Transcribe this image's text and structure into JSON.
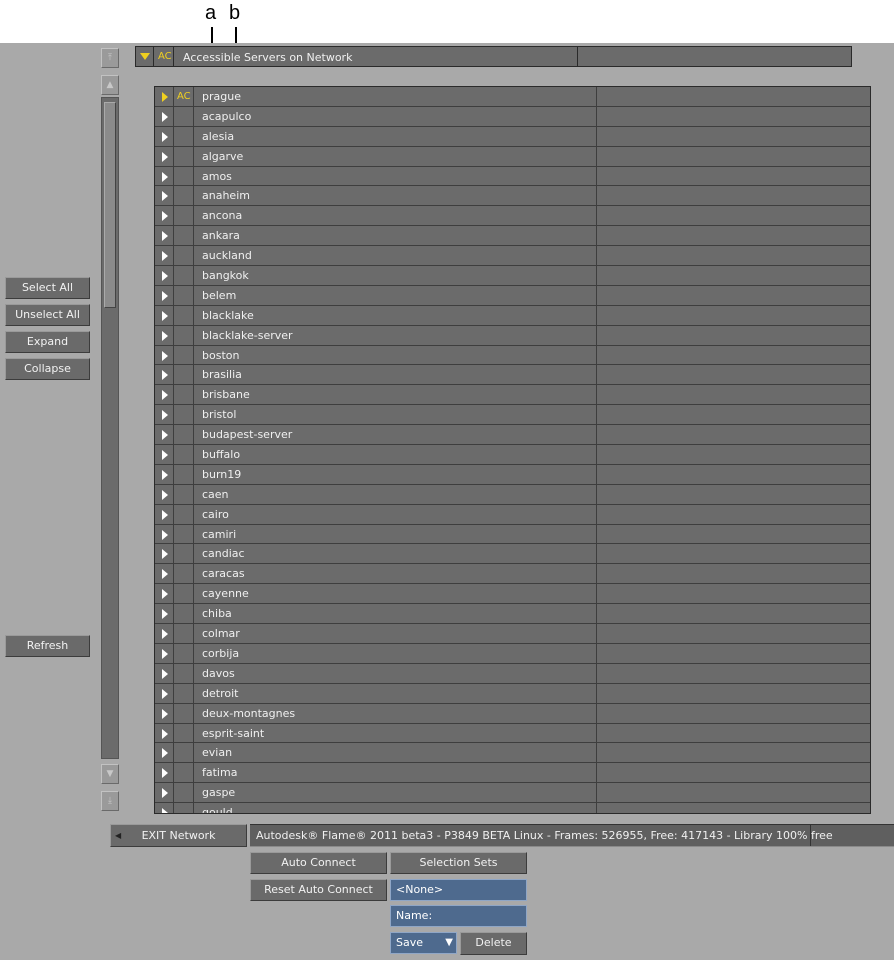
{
  "callouts": {
    "a": "a",
    "b": "b"
  },
  "left_buttons": {
    "select_all": "Select All",
    "unselect_all": "Unselect All",
    "expand": "Expand",
    "collapse": "Collapse",
    "refresh": "Refresh"
  },
  "header": {
    "ac": "AC",
    "title": "Accessible Servers on Network"
  },
  "list": {
    "ac": "AC",
    "rows": [
      "prague",
      "acapulco",
      "alesia",
      "algarve",
      "amos",
      "anaheim",
      "ancona",
      "ankara",
      "auckland",
      "bangkok",
      "belem",
      "blacklake",
      "blacklake-server",
      "boston",
      "brasilia",
      "brisbane",
      "bristol",
      "budapest-server",
      "buffalo",
      "burn19",
      "caen",
      "cairo",
      "camiri",
      "candiac",
      "caracas",
      "cayenne",
      "chiba",
      "colmar",
      "corbija",
      "davos",
      "detroit",
      "deux-montagnes",
      "esprit-saint",
      "evian",
      "fatima",
      "gaspe",
      "gould"
    ]
  },
  "footer": {
    "exit_label": "EXIT Network",
    "status": "Autodesk® Flame® 2011 beta3 - P3849 BETA Linux - Frames: 526955, Free: 417143 - Library 100% free",
    "auto_connect": "Auto Connect",
    "reset_auto_connect": "Reset Auto Connect",
    "selection_sets": "Selection Sets",
    "selection_value": "<None>",
    "name_label": "Name:",
    "save_label": "Save",
    "delete_label": "Delete"
  },
  "colors": {
    "panel": "#a9a9a9",
    "row": "#6b6b6b",
    "accent_yellow": "#f0d020",
    "field_blue": "#4e6a8e"
  }
}
